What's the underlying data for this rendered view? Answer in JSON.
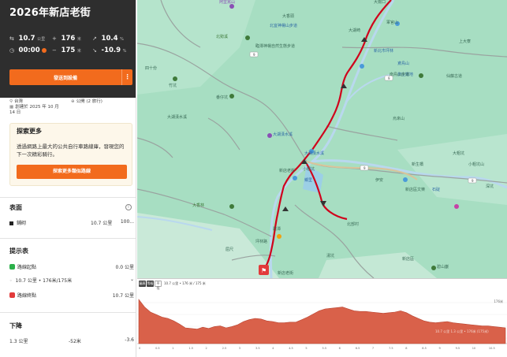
{
  "title": "2026年新店老街",
  "stats": {
    "distance": "10.7",
    "distance_unit": "公里",
    "elev_gain": "176",
    "elev_gain_unit": "米",
    "max_grade": "10.4",
    "max_grade_unit": "%",
    "time": "00:00",
    "elev_loss": "175",
    "elev_loss_unit": "米",
    "min_grade": "-10.9",
    "min_grade_unit": "%"
  },
  "send_button": "發送到設備",
  "meta": {
    "location": "台灣",
    "visibility": "公開 (2 旅行)",
    "created": "創建於 2025 年 10 月 14 日"
  },
  "explore": {
    "heading": "探索更多",
    "body": "透過網路上最大的公共自行車路線庫，發現您的下一次精彩騎行。",
    "button": "探索更多類似路線"
  },
  "surface": {
    "heading": "表面",
    "row_label": "鋪砌",
    "row_value": "10.7 公里",
    "row_pct": "100..."
  },
  "cues": {
    "heading": "提示表",
    "start_label": "路線起點",
    "start_value": "0.0 公里",
    "mid_label": "10.7 公里 • 176米/175米",
    "end_label": "路線終點",
    "end_value": "10.7 公里"
  },
  "descent": {
    "heading": "下降",
    "distance": "1.3 公里",
    "drop": "-52米",
    "grade": "-3.6"
  },
  "map": {
    "labels": [
      "大崙口",
      "阿里罵山",
      "大湖崎",
      "大香頭",
      "北宜神楊山步道",
      "臨潭神楊自然生態步道",
      "北勢溪",
      "新北市坪林",
      "上大寮",
      "軍官山",
      "旅庄鐵地",
      "鳶鳥山",
      "南鳥山步道",
      "仙藤古道",
      "竹坑",
      "番仔坑",
      "烏來山",
      "四十份",
      "大湖漢水溪",
      "大湖漢水溪",
      "大湖漢水溪",
      "小粗坑",
      "大粗坑",
      "鄉里",
      "新店老街",
      "碧潭",
      "屈尺",
      "伊安",
      "新生橋",
      "新店區文樂",
      "大香林",
      "坪林路",
      "新店區",
      "碧山巖",
      "石碇",
      "小粗坑山",
      "深坑",
      "湯坑",
      "北部村",
      "新店老街"
    ],
    "highway_labels": [
      "9",
      "9",
      "9",
      "9"
    ],
    "start_marker": "⚑"
  },
  "elevation": {
    "toolbar": [
      "圖表",
      "等級",
      "平坦"
    ],
    "legend": "10.7 公里 • 176 米 / 175 米",
    "hover_text": "10.7 公里 1.3 公里 • 176米 (175米)",
    "max_label": "176米",
    "x_ticks": [
      "0",
      "0.5",
      "1",
      "1.5",
      "2",
      "2.5",
      "3",
      "3.5",
      "4",
      "4.5",
      "5",
      "5.5",
      "6",
      "6.5",
      "7",
      "7.5",
      "8",
      "8.5",
      "9",
      "9.5",
      "10",
      "10.5"
    ],
    "fill_color": "#d9614a",
    "profile": [
      70,
      58,
      50,
      46,
      42,
      40,
      36,
      31,
      25,
      24,
      23,
      26,
      24,
      27,
      28,
      25,
      27,
      30,
      35,
      38,
      40,
      39,
      36,
      35,
      33,
      33,
      34,
      34,
      38,
      42,
      47,
      52,
      55,
      56,
      57,
      58,
      55,
      52,
      51,
      51,
      50,
      49,
      48,
      49,
      50,
      52,
      49,
      44,
      40,
      36,
      34,
      33,
      34,
      35,
      33,
      32,
      31,
      30,
      29,
      28,
      28,
      27,
      26,
      25
    ]
  },
  "colors": {
    "accent": "#f26b1d",
    "route": "#d0021b",
    "map_bg": "#a7dec2",
    "header_bg": "#2e2e2e"
  }
}
